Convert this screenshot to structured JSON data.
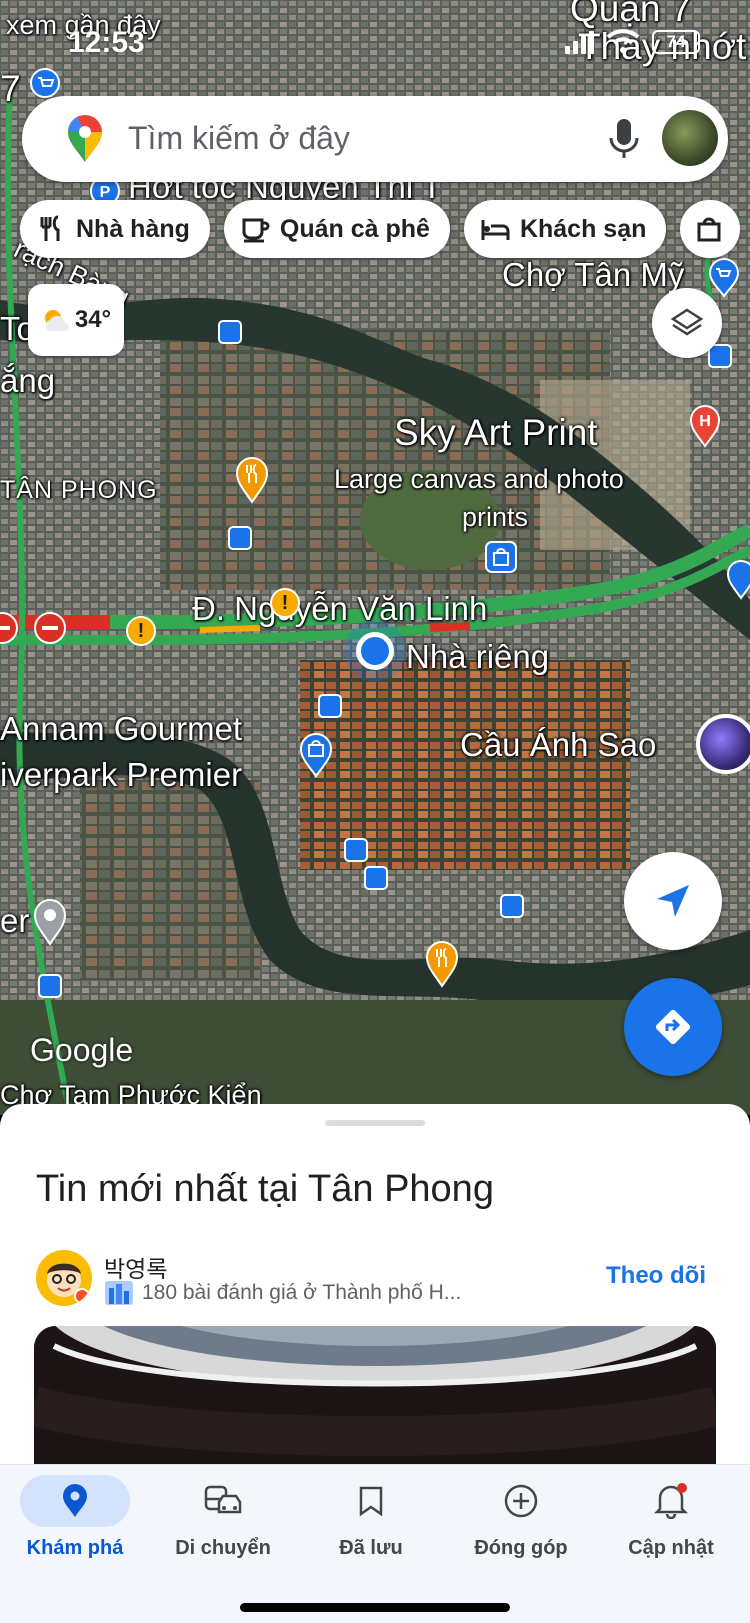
{
  "status_bar": {
    "time": "12:53",
    "battery": "74"
  },
  "map": {
    "labels": {
      "top_left_1": "xem gần đây",
      "top_right": "Quận 7",
      "top_right_2": "Thay nhớt",
      "hot_toc": "Hớt tóc Nguyễn Thị T",
      "rach": "rạch Bàng",
      "cho_tan_my": "Chợ Tân Mỹ",
      "to": "To",
      "ang": "ắng",
      "sky_art": "Sky Art Print",
      "large_canvas": "Large canvas and photo",
      "prints": "prints",
      "tan_phong": "TÂN PHONG",
      "nguyen_van_linh": "Đ. Nguyễn Văn Linh",
      "nha_rieng": "Nhà riêng",
      "annam": "Annam Gourmet",
      "riverpark": "iverpark Premier",
      "cau_anh_sao": "Cầu Ánh Sao",
      "er": "er",
      "cho_tam_phuoc": "Chợ Tam Phước Kiển",
      "seven": "7"
    },
    "google": "Google",
    "weather_temp": "34°"
  },
  "search": {
    "placeholder": "Tìm kiếm ở đây"
  },
  "chips": [
    {
      "label": "Nhà hàng",
      "icon": "restaurant-icon"
    },
    {
      "label": "Quán cà phê",
      "icon": "coffee-icon"
    },
    {
      "label": "Khách sạn",
      "icon": "hotel-icon"
    },
    {
      "label": "",
      "icon": "shopping-bag-icon"
    }
  ],
  "sheet": {
    "title": "Tin mới nhất tại Tân Phong",
    "poster_name": "박영록",
    "poster_meta": "180 bài đánh giá ở Thành phố H...",
    "follow_label": "Theo dõi"
  },
  "nav": [
    {
      "label": "Khám phá",
      "icon": "explore-pin-icon",
      "active": true
    },
    {
      "label": "Di chuyển",
      "icon": "commute-icon"
    },
    {
      "label": "Đã lưu",
      "icon": "bookmark-icon"
    },
    {
      "label": "Đóng góp",
      "icon": "add-circle-icon"
    },
    {
      "label": "Cập nhật",
      "icon": "bell-icon"
    }
  ],
  "colors": {
    "accent": "#1a73e8",
    "nav_active_bg": "#d3e3fd",
    "traffic_green": "#34a853",
    "traffic_red": "#d93025",
    "poi_orange": "#f29900"
  }
}
